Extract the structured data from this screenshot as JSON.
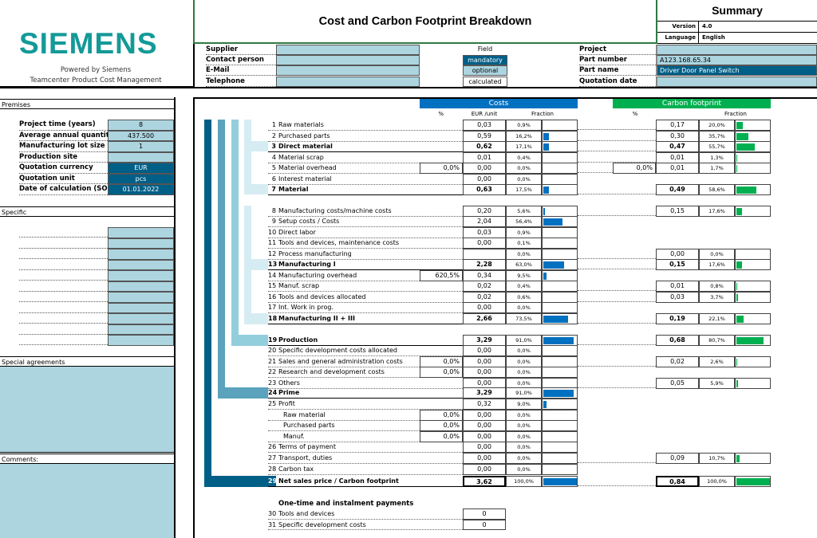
{
  "branding": {
    "logo": "SIEMENS",
    "powered_by": "Powered by Siemens",
    "product": "Teamcenter Product Cost Management"
  },
  "header": {
    "title": "Cost and Carbon Footprint Breakdown",
    "summary": "Summary",
    "version_label": "Version",
    "version": "4.0",
    "language_label": "Language",
    "language": "English"
  },
  "contact": {
    "supplier_label": "Supplier",
    "supplier": "",
    "contact_label": "Contact person",
    "contact": "",
    "email_label": "E-Mail",
    "email": "",
    "telephone_label": "Telephone",
    "telephone": ""
  },
  "legend": {
    "title": "Field",
    "mandatory": "mandatory",
    "optional": "optional",
    "calculated": "calculated"
  },
  "project": {
    "project_label": "Project",
    "project": "",
    "part_number_label": "Part number",
    "part_number": "A123.168.65.34",
    "part_name_label": "Part name",
    "part_name": "Driver Door Panel Switch",
    "quotation_date_label": "Quotation date",
    "quotation_date": ""
  },
  "premises": {
    "title": "Premises",
    "items": [
      {
        "label": "Project time (years)",
        "value": "8",
        "kind": "optional"
      },
      {
        "label": "Average annual quantit",
        "value": "437.500",
        "kind": "optional"
      },
      {
        "label": "Manufacturing lot size",
        "value": "1",
        "kind": "optional"
      },
      {
        "label": "Production site",
        "value": "",
        "kind": "optional"
      },
      {
        "label": "Quotation currency",
        "value": "EUR",
        "kind": "mandatory"
      },
      {
        "label": "Quotation unit",
        "value": "pcs",
        "kind": "mandatory"
      },
      {
        "label": "Date of calculation (SO",
        "value": "01.01.2022",
        "kind": "mandatory"
      }
    ]
  },
  "specific": {
    "title": "Specific",
    "rows": 11
  },
  "special_agreements": {
    "title": "Special agreements"
  },
  "comments": {
    "title": "Comments:"
  },
  "costs_header": {
    "costs": "Costs",
    "carbon": "Carbon footprint",
    "pct": "%",
    "eur_unit": "EUR /unit",
    "fraction": "Fraction",
    "cf_pct": "%",
    "cf_fraction": "Fraction"
  },
  "colors": {
    "costs_bar": "#0070c0",
    "carbon_bar": "#00b050",
    "mandatory": "#005f87",
    "optional": "#acd5e0"
  },
  "rows": [
    {
      "n": "1",
      "label": "Raw materials",
      "bold": false,
      "cost": "0,03",
      "cfrac": "0,9%",
      "cval": 0.9,
      "co2": "0,17",
      "co2frac": "20,0%",
      "co2val": 20.0
    },
    {
      "n": "2",
      "label": "Purchased parts",
      "bold": false,
      "cost": "0,59",
      "cfrac": "16,2%",
      "cval": 16.2,
      "co2": "0,30",
      "co2frac": "35,7%",
      "co2val": 35.7
    },
    {
      "n": "3",
      "label": "Direct material",
      "bold": true,
      "cost": "0,62",
      "cfrac": "17,1%",
      "cval": 17.1,
      "co2": "0,47",
      "co2frac": "55,7%",
      "co2val": 55.7
    },
    {
      "n": "4",
      "label": "Material scrap",
      "bold": false,
      "cost": "0,01",
      "cfrac": "0,4%",
      "cval": 0.4,
      "co2": "0,01",
      "co2frac": "1,3%",
      "co2val": 1.3
    },
    {
      "n": "5",
      "label": "Material overhead",
      "bold": false,
      "pct": "0,0%",
      "cost": "0,00",
      "cfrac": "0,0%",
      "cval": 0,
      "co2pct": "0,0%",
      "co2": "0,01",
      "co2frac": "1,7%",
      "co2val": 1.7
    },
    {
      "n": "6",
      "label": "Interest material",
      "bold": false,
      "cost": "0,00",
      "cost_input": true,
      "cfrac": "0,0%",
      "cval": 0
    },
    {
      "n": "7",
      "label": "Material",
      "bold": true,
      "cost": "0,63",
      "cfrac": "17,5%",
      "cval": 17.5,
      "co2": "0,49",
      "co2frac": "58,6%",
      "co2val": 58.6
    },
    {
      "n": "8",
      "label": "Manufacturing costs/machine costs",
      "bold": false,
      "cost": "0,20",
      "cfrac": "5,6%",
      "cval": 5.6,
      "co2": "0,15",
      "co2frac": "17,6%",
      "co2val": 17.6
    },
    {
      "n": "9",
      "label": "Setup costs / Costs",
      "bold": false,
      "cost": "2,04",
      "cfrac": "56,4%",
      "cval": 56.4
    },
    {
      "n": "10",
      "label": "Direct labor",
      "bold": false,
      "cost": "0,03",
      "cfrac": "0,9%",
      "cval": 0.9
    },
    {
      "n": "11",
      "label": "Tools and devices, maintenance costs",
      "bold": false,
      "cost": "0,00",
      "cfrac": "0,1%",
      "cval": 0.1
    },
    {
      "n": "12",
      "label": "Process manufacturing",
      "bold": false,
      "cost": "",
      "cfrac": "0,0%",
      "cval": 0,
      "co2": "0,00",
      "co2frac": "0,0%",
      "co2val": 0
    },
    {
      "n": "13",
      "label": "Manufacturing I",
      "bold": true,
      "cost": "2,28",
      "cfrac": "63,0%",
      "cval": 63.0,
      "co2": "0,15",
      "co2frac": "17,6%",
      "co2val": 17.6
    },
    {
      "n": "14",
      "label": "Manufacturing overhead",
      "bold": false,
      "pct": "620,5%",
      "cost": "0,34",
      "cfrac": "9,5%",
      "cval": 9.5
    },
    {
      "n": "15",
      "label": "Manuf. scrap",
      "bold": false,
      "cost": "0,02",
      "cfrac": "0,4%",
      "cval": 0.4,
      "co2": "0,01",
      "co2frac": "0,8%",
      "co2val": 0.8
    },
    {
      "n": "16",
      "label": "Tools and devices allocated",
      "bold": false,
      "cost": "0,02",
      "cfrac": "0,6%",
      "cval": 0.6,
      "co2": "0,03",
      "co2frac": "3,7%",
      "co2val": 3.7
    },
    {
      "n": "17",
      "label": "Int. Work in prog.",
      "bold": false,
      "cost": "0,00",
      "cost_input": true,
      "cfrac": "0,0%",
      "cval": 0
    },
    {
      "n": "18",
      "label": "Manufacturing II + III",
      "bold": true,
      "cost": "2,66",
      "cfrac": "73,5%",
      "cval": 73.5,
      "co2": "0,19",
      "co2frac": "22,1%",
      "co2val": 22.1
    },
    {
      "n": "19",
      "label": "Production",
      "bold": true,
      "cost": "3,29",
      "cfrac": "91,0%",
      "cval": 91.0,
      "co2": "0,68",
      "co2frac": "80,7%",
      "co2val": 80.7
    },
    {
      "n": "20",
      "label": "Specific development costs allocated",
      "bold": false,
      "cost": "0,00",
      "cfrac": "0,0%",
      "cval": 0
    },
    {
      "n": "21",
      "label": "Sales and general administration costs",
      "bold": false,
      "pct": "0,0%",
      "pct_input": true,
      "cost": "0,00",
      "cfrac": "0,0%",
      "cval": 0,
      "co2": "0,02",
      "co2frac": "2,6%",
      "co2val": 2.6
    },
    {
      "n": "22",
      "label": "Research and development costs",
      "bold": false,
      "pct": "0,0%",
      "pct_input": true,
      "cost": "0,00",
      "cfrac": "0,0%",
      "cval": 0
    },
    {
      "n": "23",
      "label": "Others",
      "bold": false,
      "cost": "0,00",
      "cost_input": true,
      "cfrac": "0,0%",
      "cval": 0,
      "co2": "0,05",
      "co2frac": "5,9%",
      "co2val": 5.9
    },
    {
      "n": "24",
      "label": "Prime",
      "bold": true,
      "cost": "3,29",
      "cfrac": "91,0%",
      "cval": 91.0
    },
    {
      "n": "25",
      "label": "Profit",
      "bold": false,
      "cost": "0,32",
      "cfrac": "9,0%",
      "cval": 9.0
    },
    {
      "n": "",
      "label": "Raw material",
      "bold": false,
      "indent": true,
      "pct": "0,0%",
      "pct_input": true,
      "cost": "0,00",
      "cfrac": "0,0%",
      "cval": 0
    },
    {
      "n": "",
      "label": "Purchased parts",
      "bold": false,
      "indent": true,
      "pct": "0,0%",
      "pct_input": true,
      "cost": "0,00",
      "cfrac": "0,0%",
      "cval": 0
    },
    {
      "n": "",
      "label": "Manuf.",
      "bold": false,
      "indent": true,
      "pct": "0,0%",
      "pct_input": true,
      "cost": "0,00",
      "cfrac": "0,0%",
      "cval": 0
    },
    {
      "n": "26",
      "label": "Terms of payment",
      "bold": false,
      "cost": "0,00",
      "cost_input": true,
      "cfrac": "0,0%",
      "cval": 0
    },
    {
      "n": "27",
      "label": "Transport, duties",
      "bold": false,
      "cost": "0,00",
      "cost_input": true,
      "cfrac": "0,0%",
      "cval": 0,
      "co2": "0,09",
      "co2frac": "10,7%",
      "co2val": 10.7
    },
    {
      "n": "28",
      "label": "Carbon tax",
      "bold": false,
      "cost": "0,00",
      "cost_input": true,
      "cfrac": "0,0%",
      "cval": 0
    },
    {
      "n": "29",
      "label": "Net sales price / Carbon footprint",
      "bold": true,
      "cost": "3,62",
      "cfrac": "100,0%",
      "cval": 100.0,
      "co2": "0,84",
      "co2frac": "100,0%",
      "co2val": 100.0
    }
  ],
  "onetime": {
    "title": "One-time and instalment payments",
    "items": [
      {
        "n": "30",
        "label": "Tools and devices",
        "value": "0",
        "input": false
      },
      {
        "n": "31",
        "label": "Specific development costs",
        "value": "0",
        "input": true
      }
    ]
  }
}
